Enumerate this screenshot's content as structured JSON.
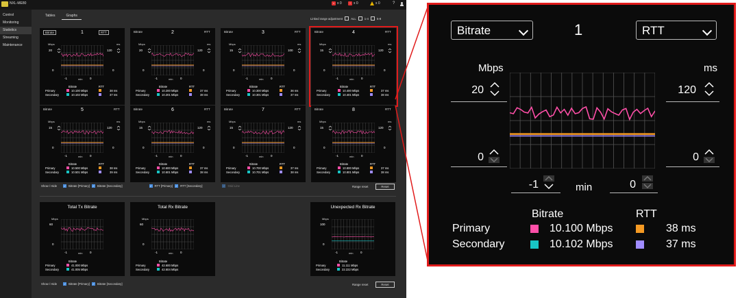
{
  "app": {
    "name": "NXL-ME80",
    "error_count": "x 0",
    "error2_count": "x 0",
    "warning_count": "x 0",
    "help": "?",
    "colors": {
      "primary": "#ff4fa8",
      "secondary": "#18c4c4",
      "rtt_primary": "#f59a23",
      "rtt_secondary": "#a08cff",
      "accent": "#e11b1b"
    }
  },
  "sidebar": {
    "items": [
      {
        "label": "Control"
      },
      {
        "label": "Monitoring"
      },
      {
        "label": "Statistics"
      },
      {
        "label": "Streaming"
      },
      {
        "label": "Maintenance"
      }
    ]
  },
  "tabs": [
    {
      "label": "Tables"
    },
    {
      "label": "Graphs"
    }
  ],
  "linked": {
    "label": "Linked range adjustment",
    "opt_all": "ALL",
    "opt_14": "1-4",
    "opt_58": "5-8"
  },
  "panels": [
    {
      "num": "1",
      "left_sel": "Bitrate",
      "right_sel": "RTT",
      "ymax": "20",
      "ymin": "0",
      "rmax": "120",
      "rmin": "0",
      "tmin": "-1",
      "tmax": "0",
      "unit_l": "Mbps",
      "unit_r": "ms",
      "min_label": "min",
      "bitrate_h": "Bitrate",
      "rtt_h": "RTT",
      "primary_label": "Primary",
      "secondary_label": "Secondary",
      "p_bitrate": "10.100 Mbps",
      "s_bitrate": "10.102 Mbps",
      "p_rtt": "38 ms",
      "s_rtt": "37 ms"
    },
    {
      "num": "2",
      "left_sel": "Bitrate",
      "right_sel": "RTT",
      "ymax": "20",
      "ymin": "0",
      "rmax": "120",
      "rmin": "0",
      "tmin": "-1",
      "tmax": "0",
      "unit_l": "Mbps",
      "unit_r": "ms",
      "min_label": "min",
      "bitrate_h": "Bitrate",
      "rtt_h": "RTT",
      "primary_label": "Primary",
      "secondary_label": "Secondary",
      "p_bitrate": "10.200 Mbps",
      "s_bitrate": "10.201 Mbps",
      "p_rtt": "37 ms",
      "s_rtt": "38 ms"
    },
    {
      "num": "3",
      "left_sel": "Bitrate",
      "right_sel": "RTT",
      "ymax": "15",
      "ymin": "0",
      "rmax": "100",
      "rmin": "0",
      "tmin": "-1",
      "tmax": "0",
      "unit_l": "Mbps",
      "unit_r": "ms",
      "min_label": "min",
      "bitrate_h": "Bitrate",
      "rtt_h": "RTT",
      "primary_label": "Primary",
      "secondary_label": "Secondary",
      "p_bitrate": "10.300 Mbps",
      "s_bitrate": "10.301 Mbps",
      "p_rtt": "36 ms",
      "s_rtt": "37 ms"
    },
    {
      "num": "4",
      "left_sel": "Bitrate",
      "right_sel": "RTT",
      "ymax": "15",
      "ymin": "0",
      "rmax": "120",
      "rmin": "0",
      "tmin": "-1",
      "tmax": "0",
      "unit_l": "Mbps",
      "unit_r": "ms",
      "min_label": "min",
      "bitrate_h": "Bitrate",
      "rtt_h": "RTT",
      "primary_label": "Primary",
      "secondary_label": "Secondary",
      "p_bitrate": "10.400 Mbps",
      "s_bitrate": "10.401 Mbps",
      "p_rtt": "37 ms",
      "s_rtt": "38 ms"
    },
    {
      "num": "5",
      "left_sel": "Bitrate",
      "right_sel": "RTT",
      "ymax": "15",
      "ymin": "0",
      "rmax": "120",
      "rmin": "0",
      "tmin": "-1",
      "tmax": "0",
      "unit_l": "Mbps",
      "unit_r": "ms",
      "min_label": "min",
      "bitrate_h": "Bitrate",
      "rtt_h": "RTT",
      "primary_label": "Primary",
      "secondary_label": "Secondary",
      "p_bitrate": "10.500 Mbps",
      "s_bitrate": "10.501 Mbps",
      "p_rtt": "38 ms",
      "s_rtt": "39 ms"
    },
    {
      "num": "6",
      "left_sel": "Bitrate",
      "right_sel": "RTT",
      "ymax": "15",
      "ymin": "0",
      "rmax": "120",
      "rmin": "0",
      "tmin": "-1",
      "tmax": "0",
      "unit_l": "Mbps",
      "unit_r": "ms",
      "min_label": "min",
      "bitrate_h": "Bitrate",
      "rtt_h": "RTT",
      "primary_label": "Primary",
      "secondary_label": "Secondary",
      "p_bitrate": "10.600 Mbps",
      "s_bitrate": "10.601 Mbps",
      "p_rtt": "37 ms",
      "s_rtt": "38 ms"
    },
    {
      "num": "7",
      "left_sel": "Bitrate",
      "right_sel": "RTT",
      "ymax": "15",
      "ymin": "0",
      "rmax": "120",
      "rmin": "0",
      "tmin": "-1",
      "tmax": "0",
      "unit_l": "Mbps",
      "unit_r": "ms",
      "min_label": "min",
      "bitrate_h": "Bitrate",
      "rtt_h": "RTT",
      "primary_label": "Primary",
      "secondary_label": "Secondary",
      "p_bitrate": "10.700 Mbps",
      "s_bitrate": "10.701 Mbps",
      "p_rtt": "37 ms",
      "s_rtt": "38 ms"
    },
    {
      "num": "8",
      "left_sel": "Bitrate",
      "right_sel": "RTT",
      "ymax": "15",
      "ymin": "0",
      "rmax": "120",
      "rmin": "0",
      "tmin": "-1",
      "tmax": "0",
      "unit_l": "Mbps",
      "unit_r": "ms",
      "min_label": "min",
      "bitrate_h": "Bitrate",
      "rtt_h": "RTT",
      "primary_label": "Primary",
      "secondary_label": "Secondary",
      "p_bitrate": "10.800 Mbps",
      "s_bitrate": "10.801 Mbps",
      "p_rtt": "37 ms",
      "s_rtt": "38 ms"
    }
  ],
  "options1": {
    "label": "Show / Hide",
    "b_primary": "Bitrate [Primary]",
    "b_secondary": "Bitrate [Secondary]",
    "r_primary": "RTT [Primary]",
    "r_secondary": "RTT [Secondary]",
    "grid_line": "Grid Line",
    "range_reset": "Range reset",
    "reset": "Reset"
  },
  "totals": [
    {
      "title": "Total Tx Bitrate",
      "unit": "Mbps",
      "ymax": "60",
      "ymin": "0",
      "tmin": "-1",
      "tmax": "0",
      "min_label": "min",
      "bitrate_h": "Bitrate",
      "primary_label": "Primary",
      "secondary_label": "Secondary",
      "p_val": "41.000 Mbps",
      "s_val": "41.005 Mbps"
    },
    {
      "title": "Total Rx Bitrate",
      "unit": "Mbps",
      "ymax": "60",
      "ymin": "0",
      "tmin": "-1",
      "tmax": "0",
      "min_label": "min",
      "bitrate_h": "Bitrate",
      "primary_label": "Primary",
      "secondary_label": "Secondary",
      "p_val": "42.600 Mbps",
      "s_val": "42.604 Mbps"
    },
    {
      "title": "Unexpected Rx Bitrate",
      "unit": "Mbps",
      "ymax": "100",
      "ymin": "0",
      "tmin": "-1",
      "tmax": "0",
      "min_label": "min",
      "bitrate_h": "Bitrate",
      "primary_label": "Primary",
      "secondary_label": "Secondary",
      "p_val": "11.111 Mbps",
      "s_val": "22.222 Mbps"
    }
  ],
  "options2": {
    "label": "Show / Hide",
    "b_primary": "Bitrate [Primary]",
    "b_secondary": "Bitrate [Secondary]",
    "range_reset": "Range reset",
    "reset": "Reset"
  },
  "zoom": {
    "num": "1",
    "left_sel": "Bitrate",
    "right_sel": "RTT",
    "unit_l": "Mbps",
    "unit_r": "ms",
    "ymax": "20",
    "ymin": "0",
    "rmax": "120",
    "rmin": "0",
    "tmin": "-1",
    "tmax": "0",
    "min_label": "min",
    "bitrate_h": "Bitrate",
    "rtt_h": "RTT",
    "primary_label": "Primary",
    "secondary_label": "Secondary",
    "p_bitrate": "10.100 Mbps",
    "s_bitrate": "10.102 Mbps",
    "p_rtt": "38 ms",
    "s_rtt": "37 ms"
  }
}
